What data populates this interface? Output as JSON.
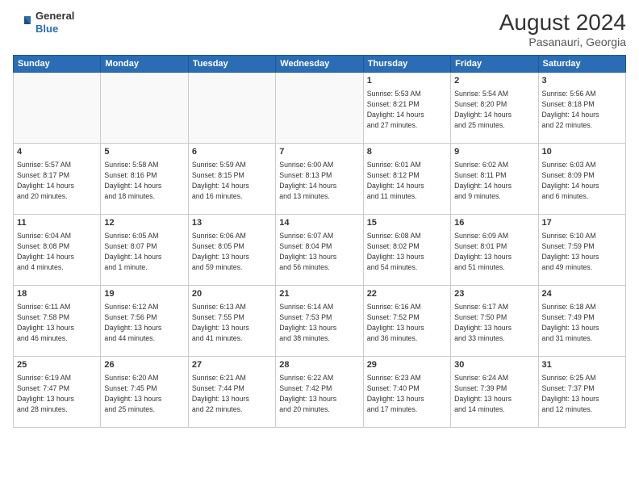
{
  "header": {
    "logo_general": "General",
    "logo_blue": "Blue",
    "month_year": "August 2024",
    "location": "Pasanauri, Georgia"
  },
  "days_of_week": [
    "Sunday",
    "Monday",
    "Tuesday",
    "Wednesday",
    "Thursday",
    "Friday",
    "Saturday"
  ],
  "weeks": [
    [
      {
        "day": "",
        "info": ""
      },
      {
        "day": "",
        "info": ""
      },
      {
        "day": "",
        "info": ""
      },
      {
        "day": "",
        "info": ""
      },
      {
        "day": "1",
        "info": "Sunrise: 5:53 AM\nSunset: 8:21 PM\nDaylight: 14 hours\nand 27 minutes."
      },
      {
        "day": "2",
        "info": "Sunrise: 5:54 AM\nSunset: 8:20 PM\nDaylight: 14 hours\nand 25 minutes."
      },
      {
        "day": "3",
        "info": "Sunrise: 5:56 AM\nSunset: 8:18 PM\nDaylight: 14 hours\nand 22 minutes."
      }
    ],
    [
      {
        "day": "4",
        "info": "Sunrise: 5:57 AM\nSunset: 8:17 PM\nDaylight: 14 hours\nand 20 minutes."
      },
      {
        "day": "5",
        "info": "Sunrise: 5:58 AM\nSunset: 8:16 PM\nDaylight: 14 hours\nand 18 minutes."
      },
      {
        "day": "6",
        "info": "Sunrise: 5:59 AM\nSunset: 8:15 PM\nDaylight: 14 hours\nand 16 minutes."
      },
      {
        "day": "7",
        "info": "Sunrise: 6:00 AM\nSunset: 8:13 PM\nDaylight: 14 hours\nand 13 minutes."
      },
      {
        "day": "8",
        "info": "Sunrise: 6:01 AM\nSunset: 8:12 PM\nDaylight: 14 hours\nand 11 minutes."
      },
      {
        "day": "9",
        "info": "Sunrise: 6:02 AM\nSunset: 8:11 PM\nDaylight: 14 hours\nand 9 minutes."
      },
      {
        "day": "10",
        "info": "Sunrise: 6:03 AM\nSunset: 8:09 PM\nDaylight: 14 hours\nand 6 minutes."
      }
    ],
    [
      {
        "day": "11",
        "info": "Sunrise: 6:04 AM\nSunset: 8:08 PM\nDaylight: 14 hours\nand 4 minutes."
      },
      {
        "day": "12",
        "info": "Sunrise: 6:05 AM\nSunset: 8:07 PM\nDaylight: 14 hours\nand 1 minute."
      },
      {
        "day": "13",
        "info": "Sunrise: 6:06 AM\nSunset: 8:05 PM\nDaylight: 13 hours\nand 59 minutes."
      },
      {
        "day": "14",
        "info": "Sunrise: 6:07 AM\nSunset: 8:04 PM\nDaylight: 13 hours\nand 56 minutes."
      },
      {
        "day": "15",
        "info": "Sunrise: 6:08 AM\nSunset: 8:02 PM\nDaylight: 13 hours\nand 54 minutes."
      },
      {
        "day": "16",
        "info": "Sunrise: 6:09 AM\nSunset: 8:01 PM\nDaylight: 13 hours\nand 51 minutes."
      },
      {
        "day": "17",
        "info": "Sunrise: 6:10 AM\nSunset: 7:59 PM\nDaylight: 13 hours\nand 49 minutes."
      }
    ],
    [
      {
        "day": "18",
        "info": "Sunrise: 6:11 AM\nSunset: 7:58 PM\nDaylight: 13 hours\nand 46 minutes."
      },
      {
        "day": "19",
        "info": "Sunrise: 6:12 AM\nSunset: 7:56 PM\nDaylight: 13 hours\nand 44 minutes."
      },
      {
        "day": "20",
        "info": "Sunrise: 6:13 AM\nSunset: 7:55 PM\nDaylight: 13 hours\nand 41 minutes."
      },
      {
        "day": "21",
        "info": "Sunrise: 6:14 AM\nSunset: 7:53 PM\nDaylight: 13 hours\nand 38 minutes."
      },
      {
        "day": "22",
        "info": "Sunrise: 6:16 AM\nSunset: 7:52 PM\nDaylight: 13 hours\nand 36 minutes."
      },
      {
        "day": "23",
        "info": "Sunrise: 6:17 AM\nSunset: 7:50 PM\nDaylight: 13 hours\nand 33 minutes."
      },
      {
        "day": "24",
        "info": "Sunrise: 6:18 AM\nSunset: 7:49 PM\nDaylight: 13 hours\nand 31 minutes."
      }
    ],
    [
      {
        "day": "25",
        "info": "Sunrise: 6:19 AM\nSunset: 7:47 PM\nDaylight: 13 hours\nand 28 minutes."
      },
      {
        "day": "26",
        "info": "Sunrise: 6:20 AM\nSunset: 7:45 PM\nDaylight: 13 hours\nand 25 minutes."
      },
      {
        "day": "27",
        "info": "Sunrise: 6:21 AM\nSunset: 7:44 PM\nDaylight: 13 hours\nand 22 minutes."
      },
      {
        "day": "28",
        "info": "Sunrise: 6:22 AM\nSunset: 7:42 PM\nDaylight: 13 hours\nand 20 minutes."
      },
      {
        "day": "29",
        "info": "Sunrise: 6:23 AM\nSunset: 7:40 PM\nDaylight: 13 hours\nand 17 minutes."
      },
      {
        "day": "30",
        "info": "Sunrise: 6:24 AM\nSunset: 7:39 PM\nDaylight: 13 hours\nand 14 minutes."
      },
      {
        "day": "31",
        "info": "Sunrise: 6:25 AM\nSunset: 7:37 PM\nDaylight: 13 hours\nand 12 minutes."
      }
    ]
  ]
}
